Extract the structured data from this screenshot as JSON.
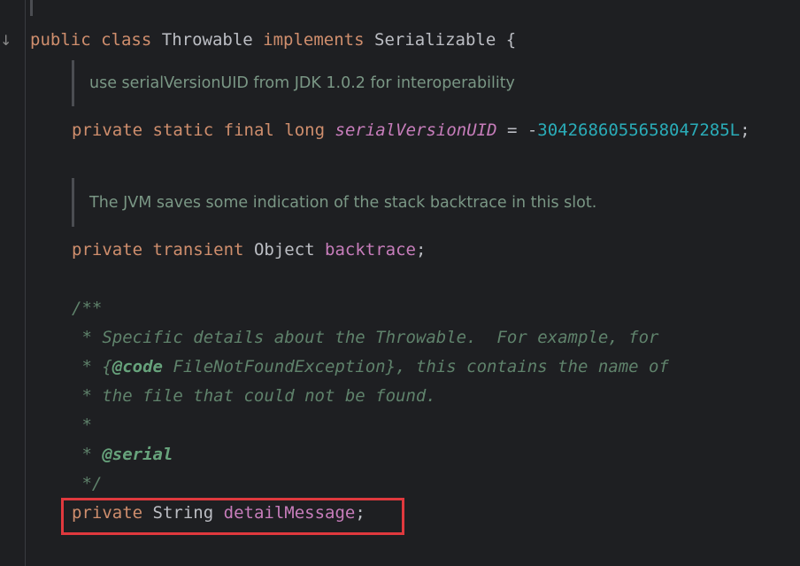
{
  "gutter": {
    "icon": "↓"
  },
  "lines": {
    "class_decl": {
      "kw1": "public",
      "kw2": "class",
      "name": "Throwable",
      "kw3": "implements",
      "iface": "Serializable",
      "brace": "{"
    },
    "doc1": "use serialVersionUID from JDK 1.0.2 for interoperability",
    "serial_field": {
      "kw1": "private",
      "kw2": "static",
      "kw3": "final",
      "kw4": "long",
      "name": "serialVersionUID",
      "eq": " = -",
      "value": "3042686055658047285L",
      "semi": ";"
    },
    "doc2": "The JVM saves some indication of the stack backtrace in this slot.",
    "backtrace_field": {
      "kw1": "private",
      "kw2": "transient",
      "type": "Object",
      "name": "backtrace",
      "semi": ";"
    },
    "javadoc": {
      "open": "/**",
      "l1": " * Specific details about the Throwable.  For example, for",
      "l2_prefix": " * {",
      "l2_tag": "@code",
      "l2_rest": " FileNotFoundException}, this contains the name of",
      "l3": " * the file that could not be found.",
      "l4": " *",
      "l5_prefix": " * ",
      "l5_tag": "@serial",
      "close": " */"
    },
    "detail_field": {
      "kw1": "private",
      "type": "String",
      "name": "detailMessage",
      "semi": ";"
    }
  },
  "colors": {
    "highlight_border": "#e0393e",
    "background": "#1e1f22"
  }
}
